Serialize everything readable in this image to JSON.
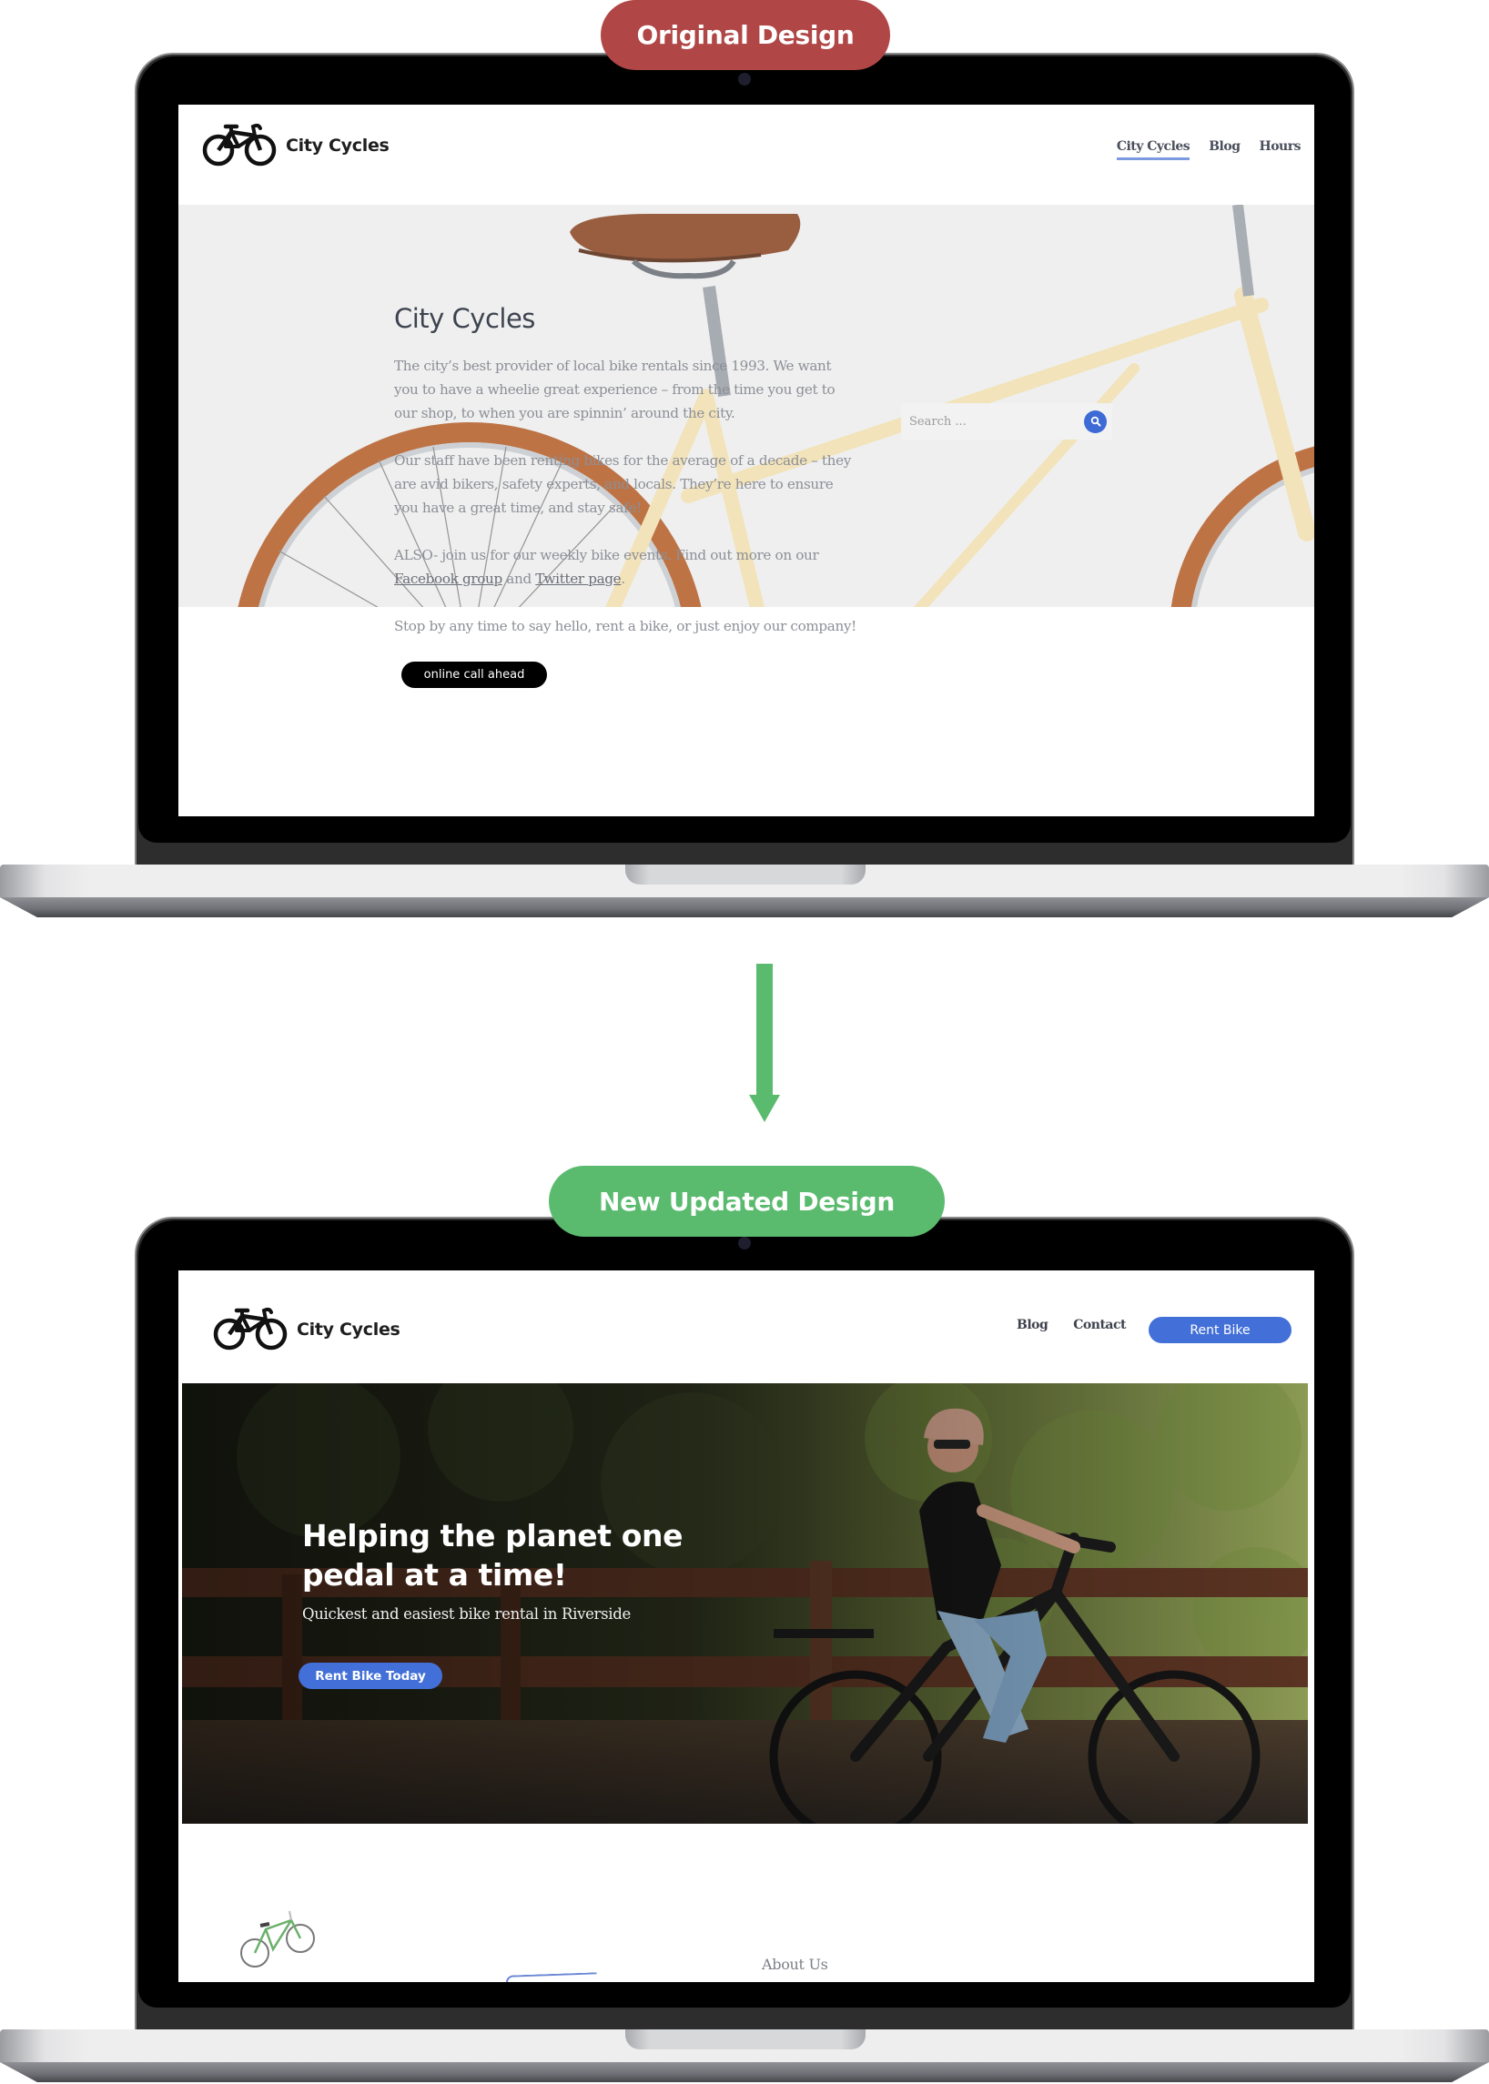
{
  "labels": {
    "original": "Original Design",
    "updated": "New Updated Design"
  },
  "colors": {
    "original_pill": "#b04646",
    "updated_pill": "#5aba6e",
    "arrow": "#5aba6e",
    "accent_blue": "#4370d8",
    "nav_underline": "#7b9ae0"
  },
  "original": {
    "logo_text": "City Cycles",
    "nav": [
      {
        "label": "City Cycles",
        "active": true
      },
      {
        "label": "Blog",
        "active": false
      },
      {
        "label": "Hours",
        "active": false
      }
    ],
    "hero_title": "City Cycles",
    "paragraphs": [
      "The city’s best provider of local bike rentals since 1993. We want you to have a wheelie great experience – from the time you get to our shop, to when you are spinnin’ around the city.",
      "Our staff have been renting bikes for the average of a decade – they are avid bikers, safety experts, and locals. They’re here to ensure you have a great time, and stay safe!"
    ],
    "also_paragraph": {
      "prefix": "ALSO- join us for our weekly bike events. Find out more on our ",
      "facebook_link": "Facebook group",
      "middle": " and ",
      "twitter_link": "Twitter page",
      "suffix": "."
    },
    "closing_paragraph": "Stop by any time to say hello, rent a bike, or just enjoy our company!",
    "cta_button": "online call ahead",
    "search": {
      "placeholder": "Search ...",
      "value": "",
      "icon": "search-icon"
    }
  },
  "updated": {
    "logo_text": "City Cycles",
    "nav": [
      {
        "label": "Blog"
      },
      {
        "label": "Contact"
      }
    ],
    "rent_button": "Rent Bike",
    "hero_heading": "Helping the planet one pedal at a time!",
    "hero_subheading": "Quickest and easiest bike rental in Riverside",
    "hero_cta": "Rent Bike Today",
    "section_title": "About Us"
  }
}
